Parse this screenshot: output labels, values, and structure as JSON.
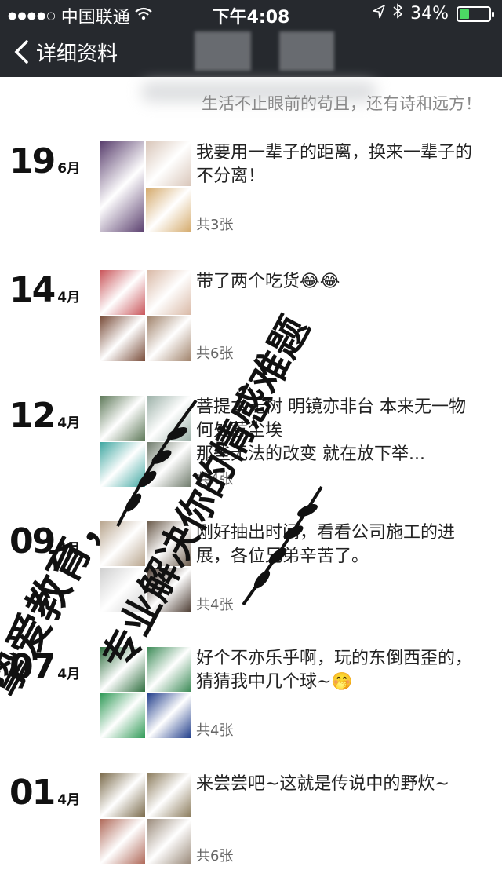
{
  "status_bar": {
    "signal": "●●●●○",
    "carrier": "中国联通",
    "time": "下午4:08",
    "battery_percent": "34%",
    "battery_level": 0.34
  },
  "nav": {
    "back_label": "详细资料"
  },
  "profile": {
    "signature": "生活不止眼前的苟且，还有诗和远方！"
  },
  "posts": [
    {
      "day": "19",
      "month": "6月",
      "caption": "我要用一辈子的距离，换来一辈子的不分离！",
      "count": "共3张",
      "thumb_colors": [
        "#5a3f6e",
        "#d9c6b9",
        "#d4a96a"
      ]
    },
    {
      "day": "14",
      "month": "4月",
      "caption": "带了两个吃货😂😂",
      "count": "共6张",
      "thumb_colors": [
        "#c9555a",
        "#d9b8a5",
        "#7a4d3a",
        "#a0826a"
      ]
    },
    {
      "day": "12",
      "month": "4月",
      "caption": "菩提本无树 明镜亦非台 本来无一物 何处惹尘埃\n那些无法的改变 就在放下举...",
      "count": "共4张",
      "thumb_colors": [
        "#5f7a5a",
        "#9bb0a7",
        "#3fa7a1",
        "#6e7a6a"
      ]
    },
    {
      "day": "09",
      "month": "4月",
      "caption": "刚好抽出时间，看看公司施工的进展，各位兄弟辛苦了。",
      "count": "共4张",
      "thumb_colors": [
        "#b9a68f",
        "#6a5a4a",
        "#cfcfcf",
        "#4a3a30"
      ]
    },
    {
      "day": "07",
      "month": "4月",
      "caption": "好个不亦乐乎啊，玩的东倒西歪的，猜猜我中几个球~🤭",
      "count": "共4张",
      "thumb_colors": [
        "#2f6f3f",
        "#3a8a55",
        "#2f9a56",
        "#1f3c8a"
      ]
    },
    {
      "day": "01",
      "month": "4月",
      "caption": "来尝尝吧~这就是传说中的野炊~",
      "count": "共6张",
      "thumb_colors": [
        "#7a6a4a",
        "#8a7a5a",
        "#b06a5a",
        "#9a8a7a"
      ]
    }
  ],
  "watermark": {
    "line1": "挚爱教育，",
    "line2": "专业解决你的情感难题"
  }
}
